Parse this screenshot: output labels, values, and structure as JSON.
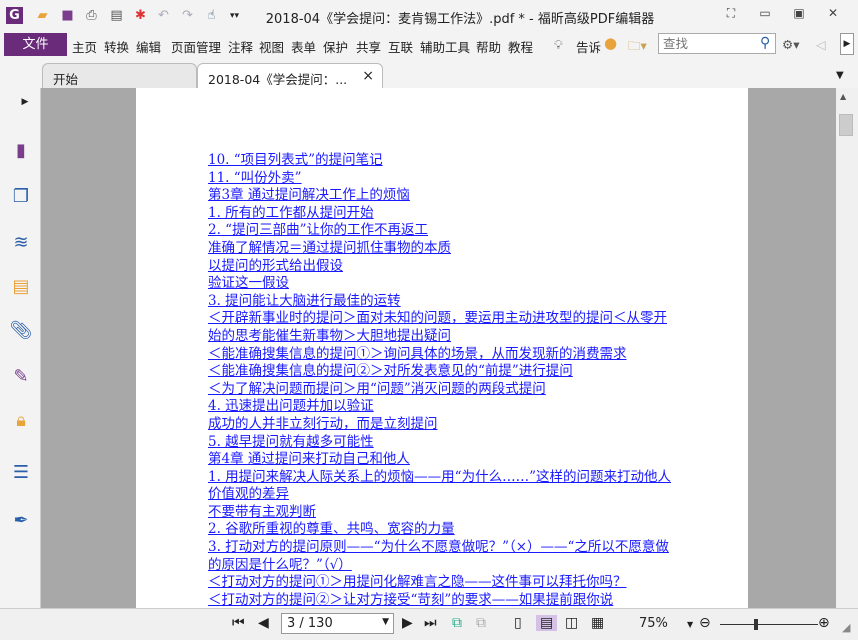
{
  "window": {
    "title": "2018-04《学会提问：麦肯锡工作法》.pdf * - 福昕高级PDF编辑器"
  },
  "toolbar": {
    "icons": [
      "app-logo-icon",
      "open-icon",
      "save-icon",
      "print-icon",
      "properties-icon",
      "new-icon",
      "undo-icon",
      "redo-icon",
      "hand-tool-icon",
      "customize-icon"
    ]
  },
  "menu": {
    "file": "文件",
    "items": [
      "主页",
      "转换",
      "编辑",
      "页面管理",
      "注释",
      "视图",
      "表单",
      "保护",
      "共享",
      "互联",
      "辅助工具",
      "帮助",
      "教程"
    ],
    "tell": "告诉",
    "search_placeholder": "查找"
  },
  "tabs": [
    {
      "label": "开始"
    },
    {
      "label": "2018-04《学会提问：...",
      "close": "×"
    }
  ],
  "sidebar": {
    "icons": [
      "page-icon",
      "pages-thumbnail-icon",
      "layers-icon",
      "comments-icon",
      "attachments-icon",
      "signature-icon",
      "security-icon",
      "form-fields-icon",
      "sign-tool-icon"
    ]
  },
  "document": {
    "lines": [
      "10. “项目列表式”的提问笔记",
      "11. “叫份外卖”",
      "第3章 通过提问解决工作上的烦恼",
      "1. 所有的工作都从提问开始",
      "2. “提问三部曲”让你的工作不再返工",
      "准确了解情况＝通过提问抓住事物的本质",
      "以提问的形式给出假设",
      "验证这一假设",
      "3. 提问能让大脑进行最佳的运转",
      "＜开辟新事业时的提问＞面对未知的问题，要运用主动进攻型的提问＜从零开始的思考能催生新事物＞大胆地提出疑问",
      "＜能准确搜集信息的提问①＞询问具体的场景，从而发现新的消费需求",
      "＜能准确搜集信息的提问②＞对所发表意见的“前提”进行提问",
      "＜为了解决问题而提问＞用“问题”消灭问题的两段式提问",
      "4. 迅速提出问题并加以验证",
      "成功的人并非立刻行动，而是立刻提问",
      "5. 越早提问就有越多可能性",
      "第4章 通过提问来打动自己和他人",
      "1. 用提问来解决人际关系上的烦恼——用“为什么……”这样的问题来打动他人",
      "价值观的差异",
      "不要带有主观判断",
      "2. 谷歌所重视的尊重、共鸣、宽容的力量",
      "3. 打动对方的提问原则——“为什么不愿意做呢？”（×）——“之所以不愿意做的原因是什么呢？”（√）",
      "＜打动对方的提问①＞用提问化解难言之隐——这件事可以拜托你吗？",
      "＜打动对方的提问②＞让对方接受“苛刻”的要求——如果提前跟你说"
    ]
  },
  "status": {
    "page": "3 / 130",
    "zoom": "75%",
    "zoom_level_percent": 75
  }
}
